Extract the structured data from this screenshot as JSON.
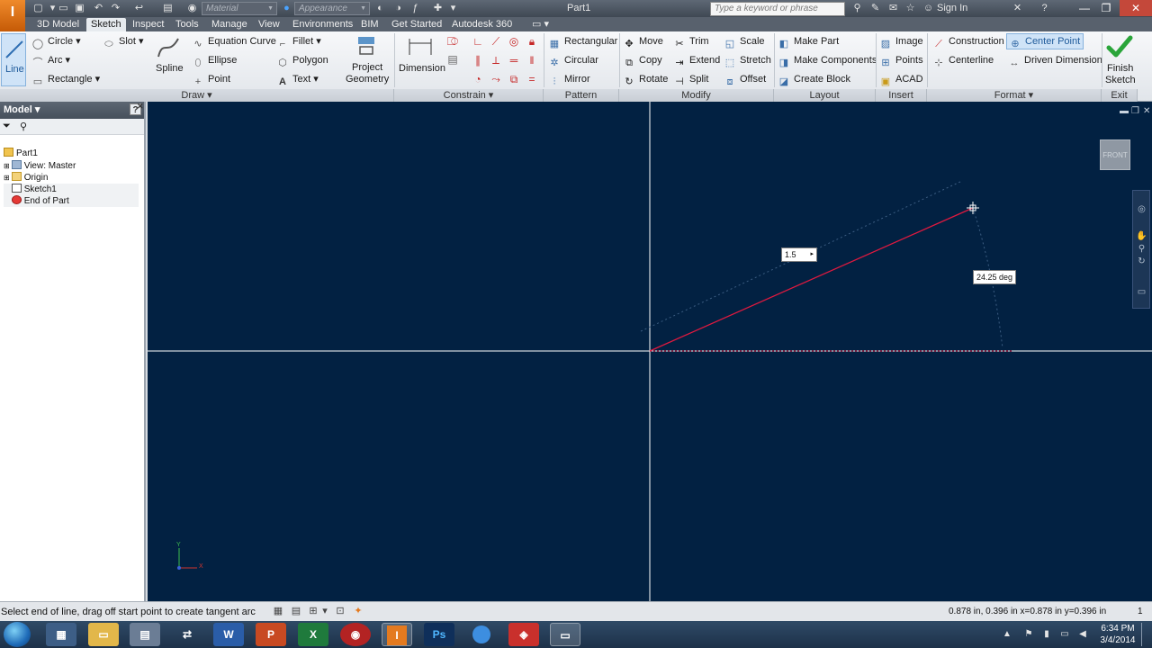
{
  "titlebar": {
    "app_logo": "I",
    "material_combo": "Material",
    "appearance_combo": "Appearance",
    "document_title": "Part1",
    "search_placeholder": "Type a keyword or phrase",
    "sign_in": "Sign In",
    "help_label": "?"
  },
  "ribbon_tabs": [
    "3D Model",
    "Sketch",
    "Inspect",
    "Tools",
    "Manage",
    "View",
    "Environments",
    "BIM",
    "Get Started",
    "Autodesk 360"
  ],
  "active_tab": "Sketch",
  "ribbon": {
    "draw": {
      "line": "Line",
      "circle": "Circle",
      "arc": "Arc",
      "rectangle": "Rectangle",
      "slot": "Slot",
      "spline": "Spline",
      "equation_curve": "Equation Curve",
      "ellipse": "Ellipse",
      "point": "Point",
      "fillet": "Fillet",
      "polygon": "Polygon",
      "text": "Text",
      "project_geometry_1": "Project",
      "project_geometry_2": "Geometry",
      "panel": "Draw"
    },
    "constrain": {
      "dimension": "Dimension",
      "panel": "Constrain"
    },
    "pattern": {
      "rectangular": "Rectangular",
      "circular": "Circular",
      "mirror": "Mirror",
      "panel": "Pattern"
    },
    "modify": {
      "move": "Move",
      "copy": "Copy",
      "rotate": "Rotate",
      "trim": "Trim",
      "extend": "Extend",
      "split": "Split",
      "scale": "Scale",
      "stretch": "Stretch",
      "offset": "Offset",
      "panel": "Modify"
    },
    "layout": {
      "make_part": "Make Part",
      "make_components": "Make Components",
      "create_block": "Create Block",
      "panel": "Layout"
    },
    "insert": {
      "image": "Image",
      "points": "Points",
      "acad": "ACAD",
      "panel": "Insert"
    },
    "format": {
      "construction": "Construction",
      "centerline": "Centerline",
      "center_point": "Center Point",
      "driven_dimension": "Driven Dimension",
      "panel": "Format"
    },
    "exit": {
      "finish_1": "Finish",
      "finish_2": "Sketch",
      "panel": "Exit"
    }
  },
  "browser": {
    "title": "Model",
    "items": [
      "Part1",
      "View: Master",
      "Origin",
      "Sketch1",
      "End of Part"
    ]
  },
  "canvas": {
    "length_input": "1.5",
    "angle_label": "24.25 deg",
    "viewcube": "FRONT",
    "axis_y": "Y",
    "axis_x": "X"
  },
  "statusbar": {
    "message": "Select end of line, drag off start point to create tangent arc",
    "coords": "0.878 in, 0.396 in  x=0.878 in  y=0.396 in",
    "count": "1"
  },
  "taskbar": {
    "apps": [
      "calendar",
      "calculator",
      "file-explorer",
      "network",
      "W",
      "P",
      "X",
      "roxio",
      "I",
      "Ps",
      "itunes",
      "sketchup",
      "window"
    ],
    "time": "6:34 PM",
    "date": "3/4/2014"
  },
  "colors": {
    "canvas_bg": "#022142",
    "sketch_line": "#e0193f",
    "axis_line": "#ffffff",
    "accent": "#e47a1f"
  }
}
